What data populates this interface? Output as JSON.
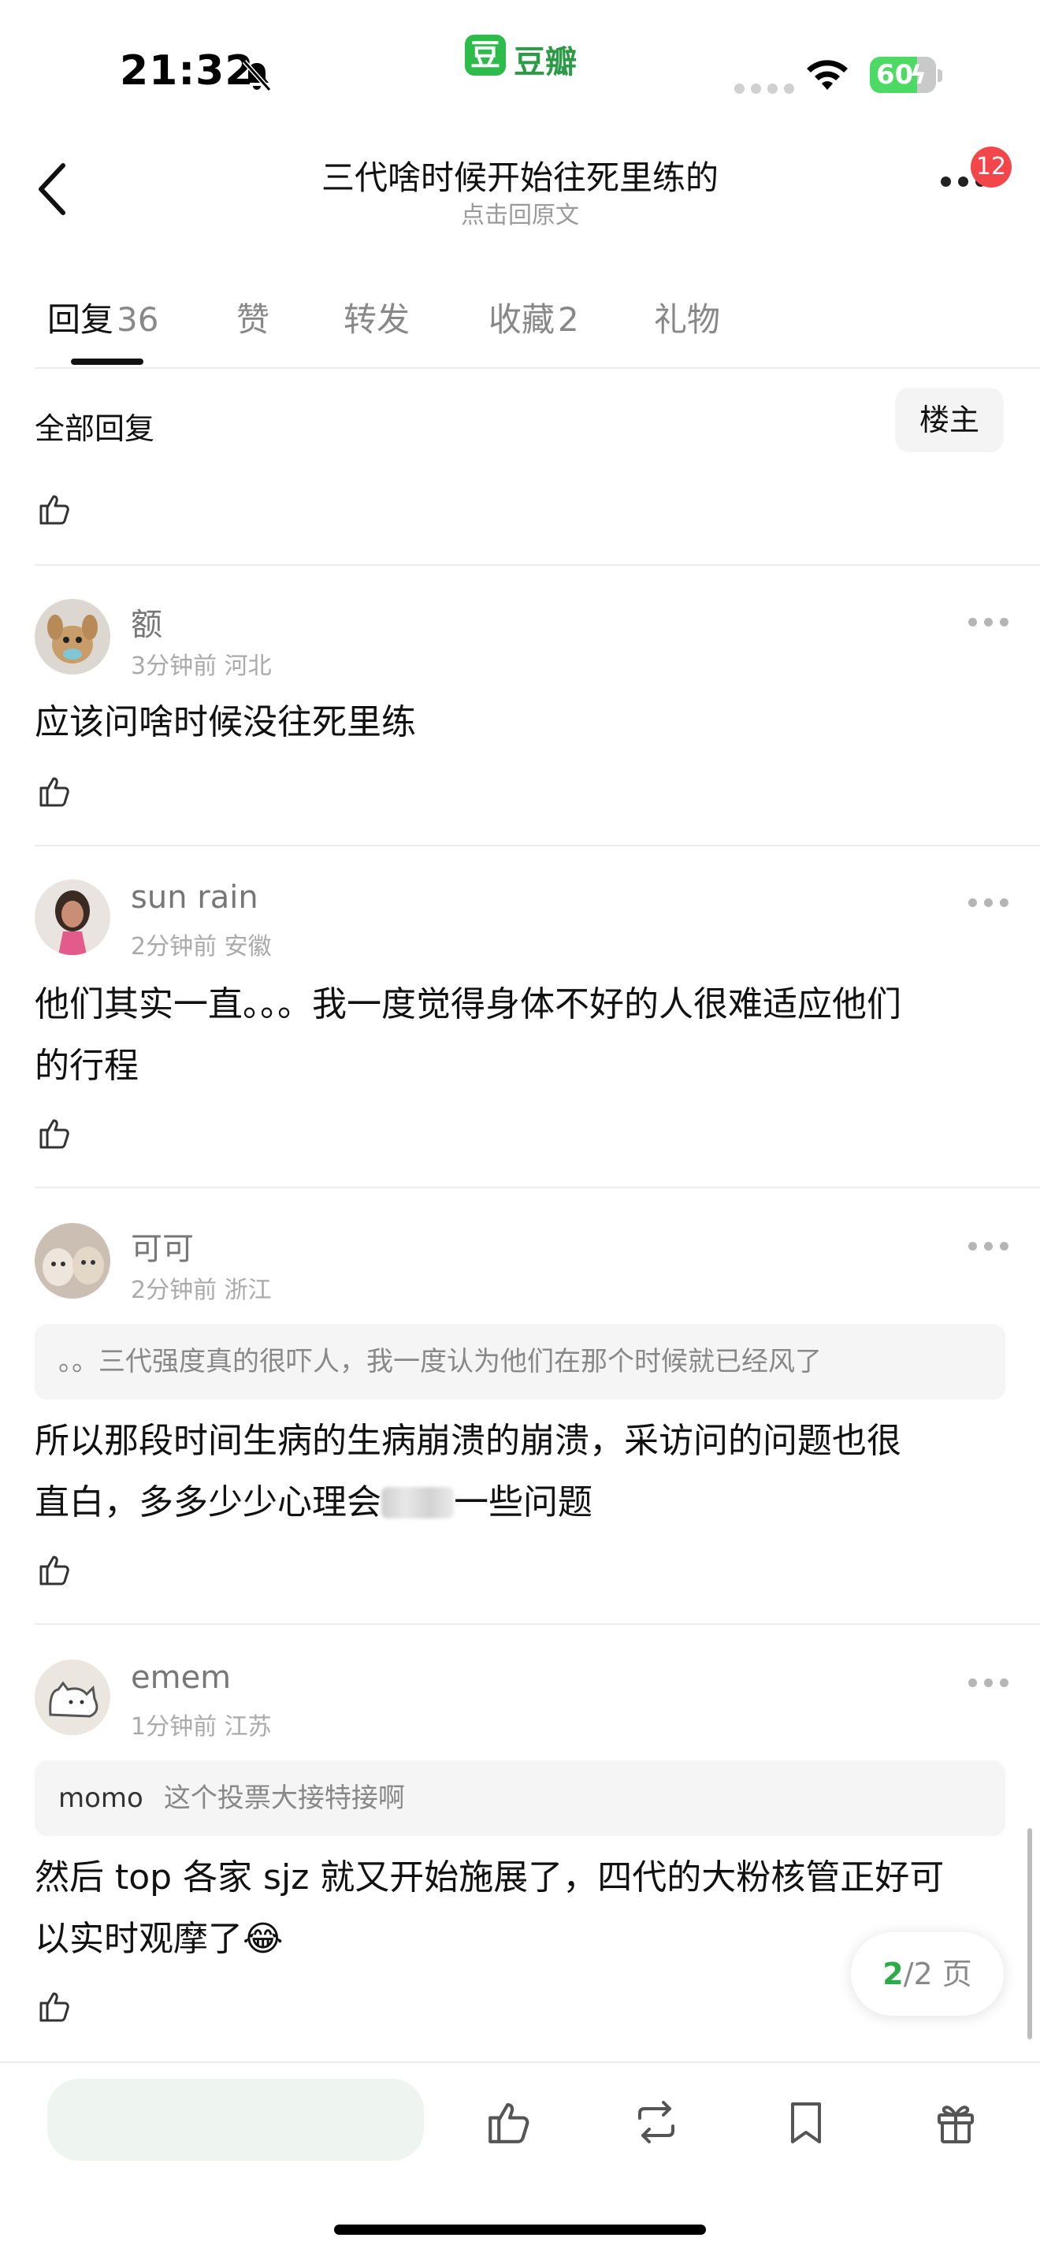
{
  "status_bar": {
    "time": "21:32",
    "app_logo_char": "豆",
    "app_name": "豆瓣",
    "battery": "60"
  },
  "nav": {
    "title": "三代啥时候开始往死里练的",
    "subtitle": "点击回原文",
    "notification_count": "12"
  },
  "tabs": [
    {
      "label": "回复",
      "count": "36",
      "active": true
    },
    {
      "label": "赞",
      "count": ""
    },
    {
      "label": "转发",
      "count": ""
    },
    {
      "label": "收藏",
      "count": "2"
    },
    {
      "label": "礼物",
      "count": ""
    }
  ],
  "filter": {
    "label": "全部回复",
    "button": "楼主"
  },
  "comments": [
    {
      "name": "额",
      "time": "3分钟前",
      "location": "河北",
      "text": "应该问啥时候没往死里练"
    },
    {
      "name": "sun rain",
      "time": "2分钟前",
      "location": "安徽",
      "text_line1": "他们其实一直。。。我一度觉得身体不好的人很难适应他们",
      "text_line2": "的行程"
    },
    {
      "name": "可可",
      "time": "2分钟前",
      "location": "浙江",
      "quote": "。。三代强度真的很吓人，我一度认为他们在那个时候就已经风了",
      "text_line1": "所以那段时间生病的生病崩溃的崩溃，采访问的问题也很",
      "text_line2_a": "直白，多多少少心理会",
      "text_line2_b": "一些问题"
    },
    {
      "name": "emem",
      "time": "1分钟前",
      "location": "江苏",
      "quote_name": "momo",
      "quote": "这个投票大接特接啊",
      "text_line1": "然后 top 各家 sjz 就又开始施展了，四代的大粉核管正好可",
      "text_line2": "以实时观摩了😂"
    }
  ],
  "pager": {
    "current": "2",
    "total": "/2 页"
  },
  "icons": [
    "bell-muted-icon",
    "wifi-icon",
    "battery-icon",
    "back-icon",
    "more-icon",
    "thumb-up-icon",
    "repost-icon",
    "bookmark-icon",
    "gift-icon"
  ],
  "colors": {
    "accent_green": "#2dab48",
    "badge_red": "#f2464a"
  }
}
